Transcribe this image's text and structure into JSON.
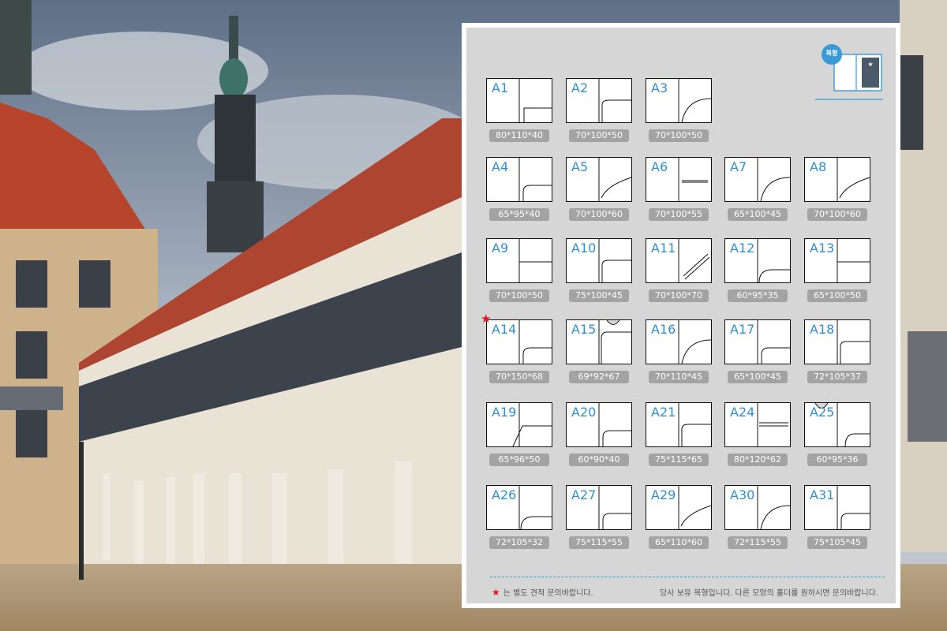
{
  "legend": {
    "badge": "목형"
  },
  "cells": [
    {
      "code": "A1",
      "dims": "80*110*40",
      "shape": "box-low"
    },
    {
      "code": "A2",
      "dims": "70*100*50",
      "shape": "round-mid"
    },
    {
      "code": "A3",
      "dims": "70*100*50",
      "shape": "curve"
    },
    {
      "code": "A4",
      "dims": "65*95*40",
      "shape": "round-low"
    },
    {
      "code": "A5",
      "dims": "70*100*60",
      "shape": "curve-soft"
    },
    {
      "code": "A6",
      "dims": "70*100*55",
      "shape": "slot"
    },
    {
      "code": "A7",
      "dims": "65*100*45",
      "shape": "curve"
    },
    {
      "code": "A8",
      "dims": "70*100*60",
      "shape": "curve-soft"
    },
    {
      "code": "A9",
      "dims": "70*100*50",
      "shape": "box-mid"
    },
    {
      "code": "A10",
      "dims": "75*100*45",
      "shape": "round-mid"
    },
    {
      "code": "A11",
      "dims": "70*100*70",
      "shape": "diagonal-slot"
    },
    {
      "code": "A12",
      "dims": "60*95*35",
      "shape": "round-full"
    },
    {
      "code": "A13",
      "dims": "65*100*50",
      "shape": "box-mid"
    },
    {
      "code": "A14",
      "dims": "70*150*68",
      "shape": "round-low",
      "star": true
    },
    {
      "code": "A15",
      "dims": "69*92*67",
      "shape": "notch"
    },
    {
      "code": "A16",
      "dims": "70*110*45",
      "shape": "curve"
    },
    {
      "code": "A17",
      "dims": "65*100*45",
      "shape": "round-low"
    },
    {
      "code": "A18",
      "dims": "72*105*37",
      "shape": "round-mid"
    },
    {
      "code": "A19",
      "dims": "65*96*50",
      "shape": "slant"
    },
    {
      "code": "A20",
      "dims": "60*90*40",
      "shape": "round-low"
    },
    {
      "code": "A21",
      "dims": "75*115*65",
      "shape": "round-mid"
    },
    {
      "code": "A24",
      "dims": "80*120*62",
      "shape": "double-slot"
    },
    {
      "code": "A25",
      "dims": "60*95*36",
      "shape": "top-notch"
    },
    {
      "code": "A26",
      "dims": "72*105*32",
      "shape": "round-full"
    },
    {
      "code": "A27",
      "dims": "75*115*55",
      "shape": "round-low"
    },
    {
      "code": "A29",
      "dims": "65*110*60",
      "shape": "curve-soft"
    },
    {
      "code": "A30",
      "dims": "72*115*55",
      "shape": "curve"
    },
    {
      "code": "A31",
      "dims": "75*105*45",
      "shape": "round-low"
    }
  ],
  "footer": {
    "star_note": "는 별도 견적 문의바랍니다.",
    "right_note": "당사 보유 목형입니다. 다른 모양의 홀더를 원하시면 문의바랍니다."
  },
  "colors": {
    "code": "#2f8fcf",
    "star": "#e01818",
    "dims_bg": "#a3a3a3",
    "panel": "#d6d6d6"
  }
}
